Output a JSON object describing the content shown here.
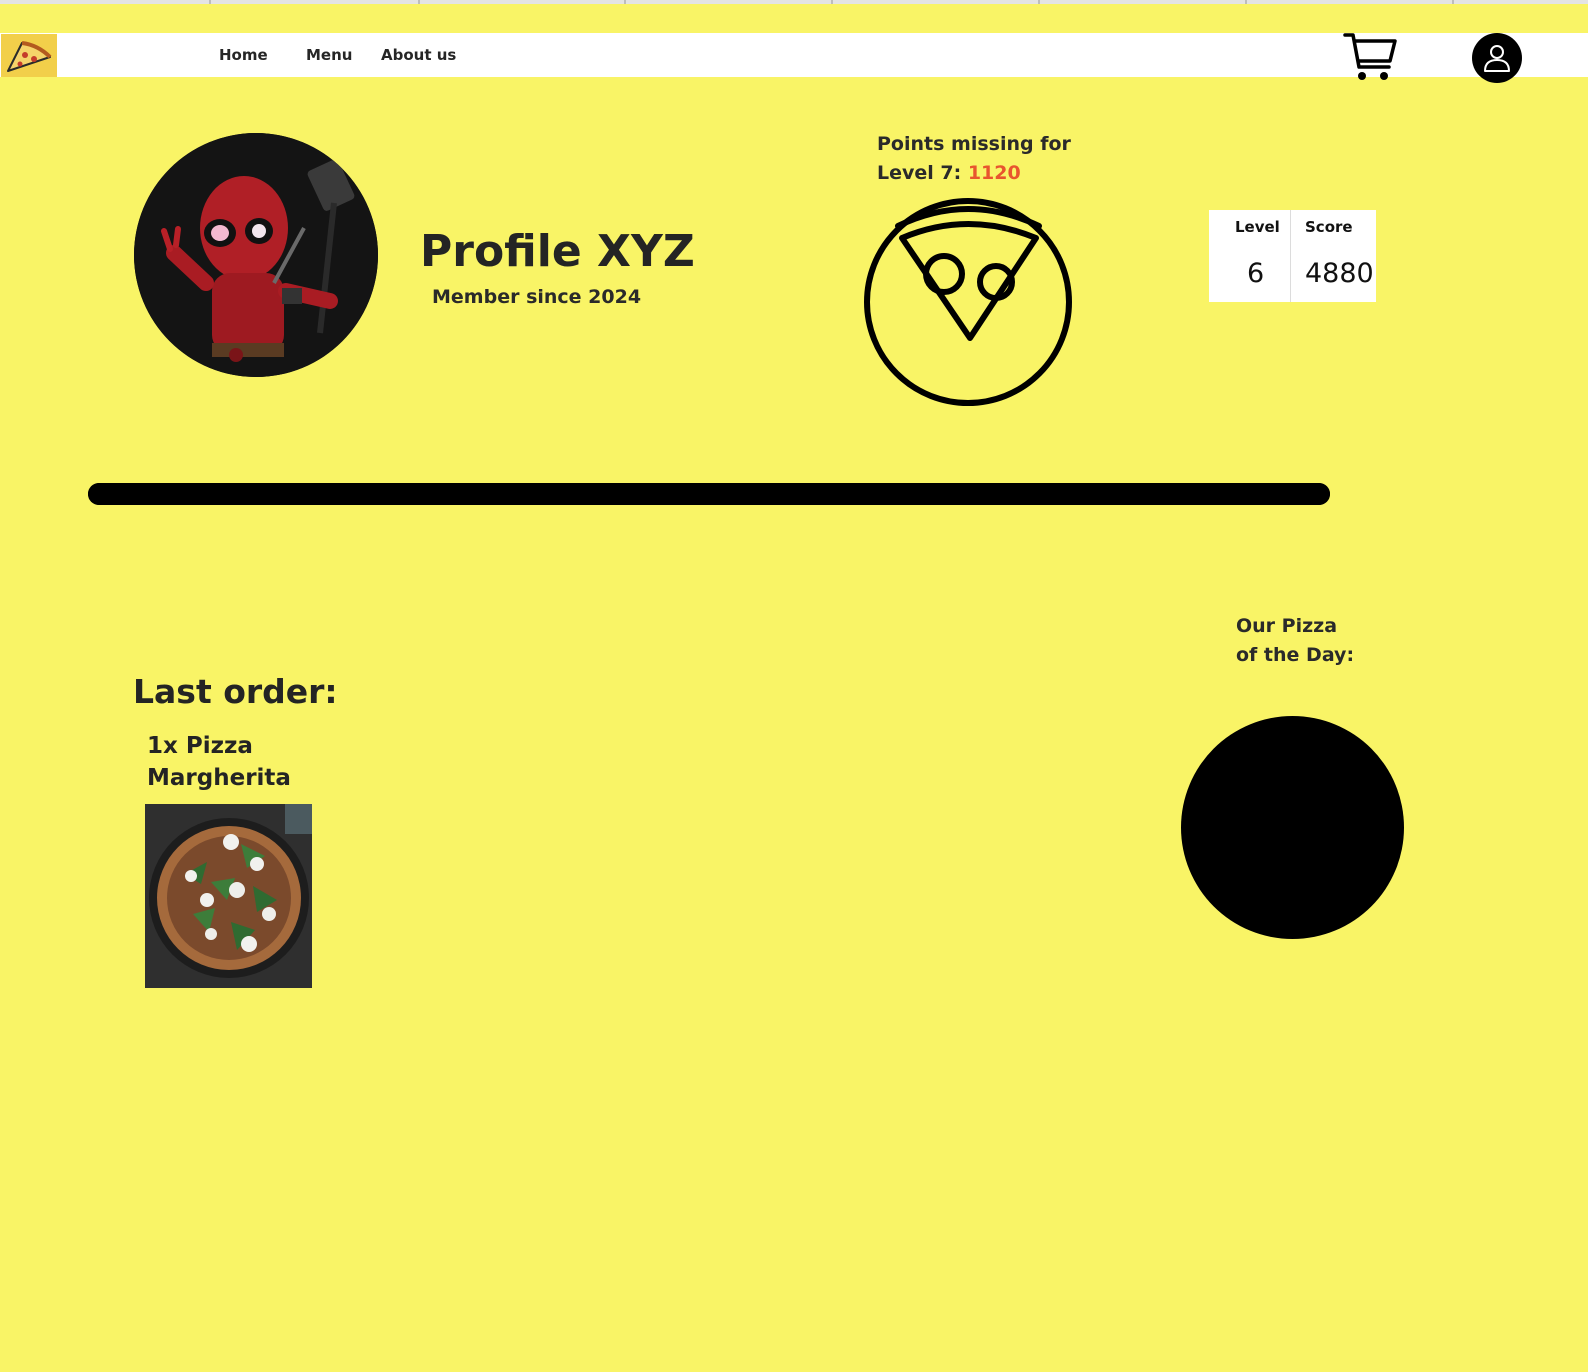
{
  "colors": {
    "page_background": "#f9f466",
    "header_background": "#ffffff",
    "accent": "#e8552e",
    "logo_background": "#f2cf4a"
  },
  "header": {
    "logo_icon": "pizza-slice-icon",
    "nav": {
      "home_label": "Home",
      "menu_label": "Menu",
      "about_label": "About us"
    },
    "cart_icon": "shopping-cart-icon",
    "account_icon": "user-icon"
  },
  "profile": {
    "title": "Profile XYZ",
    "member_since": "Member since 2024",
    "avatar_icon": "avatar-photo"
  },
  "points": {
    "label_line1": "Points missing for",
    "label_line2": "Level 7: ",
    "value": "1120",
    "badge_icon": "pizza-level-badge-icon"
  },
  "stats": {
    "level_header": "Level",
    "score_header": "Score",
    "level_value": "6",
    "score_value": "4880"
  },
  "progress": {
    "fraction": 1.0
  },
  "last_order": {
    "title": "Last order:",
    "item_line1": "1x Pizza",
    "item_line2": "Margherita",
    "image_icon": "pizza-photo"
  },
  "pizza_of_the_day": {
    "line1": "Our Pizza",
    "line2": "of the Day:"
  }
}
